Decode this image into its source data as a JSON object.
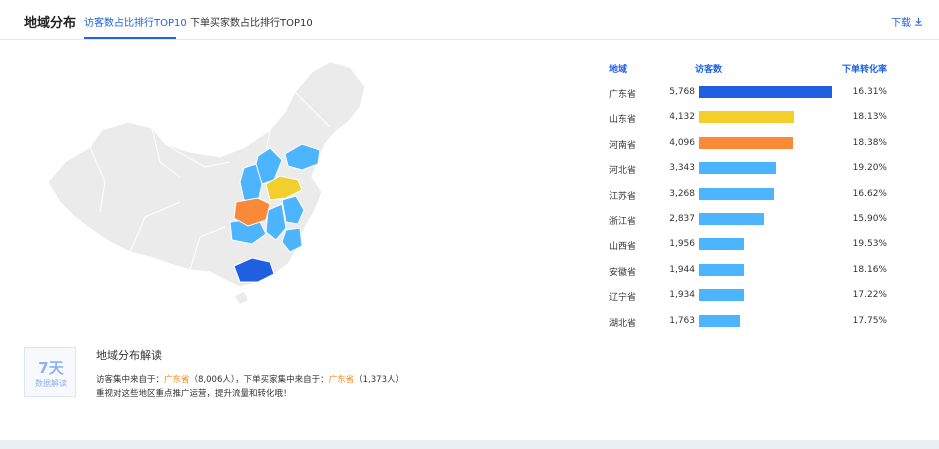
{
  "header": {
    "title": "地域分布",
    "tabs": [
      {
        "label": "访客数占比排行TOP10",
        "active": true
      },
      {
        "label": "下单买家数占比排行TOP10",
        "active": false
      }
    ],
    "download_label": "下载",
    "download_icon": "download-icon"
  },
  "table": {
    "headers": {
      "region": "地域",
      "visitors": "访客数",
      "rate": "下单转化率"
    },
    "max_visitors": 5768,
    "rows": [
      {
        "province": "广东省",
        "visitors": "5,768",
        "value": 5768,
        "rate": "16.31%",
        "color": "#1f5fe0"
      },
      {
        "province": "山东省",
        "visitors": "4,132",
        "value": 4132,
        "rate": "18.13%",
        "color": "#f2cf2d"
      },
      {
        "province": "河南省",
        "visitors": "4,096",
        "value": 4096,
        "rate": "18.38%",
        "color": "#fb8a38"
      },
      {
        "province": "河北省",
        "visitors": "3,343",
        "value": 3343,
        "rate": "19.20%",
        "color": "#4db4ff"
      },
      {
        "province": "江苏省",
        "visitors": "3,268",
        "value": 3268,
        "rate": "16.62%",
        "color": "#4db4ff"
      },
      {
        "province": "浙江省",
        "visitors": "2,837",
        "value": 2837,
        "rate": "15.90%",
        "color": "#4db4ff"
      },
      {
        "province": "山西省",
        "visitors": "1,956",
        "value": 1956,
        "rate": "19.53%",
        "color": "#4db4ff"
      },
      {
        "province": "安徽省",
        "visitors": "1,944",
        "value": 1944,
        "rate": "18.16%",
        "color": "#4db4ff"
      },
      {
        "province": "辽宁省",
        "visitors": "1,934",
        "value": 1934,
        "rate": "17.22%",
        "color": "#4db4ff"
      },
      {
        "province": "湖北省",
        "visitors": "1,763",
        "value": 1763,
        "rate": "17.75%",
        "color": "#4db4ff"
      }
    ]
  },
  "insight": {
    "badge_big": "7天",
    "badge_small": "数据解读",
    "title": "地域分布解读",
    "line1_a": "访客集中来自于：",
    "line1_b": "广东省",
    "line1_c": "（8,006人），下单买家集中来自于：",
    "line1_d": "广东省",
    "line1_e": "（1,373人）",
    "line2": "重视对这些地区重点推广运营，提升流量和转化哦！"
  },
  "colors": {
    "accent": "#2062e6",
    "map_base": "#ebebeb",
    "map_light": "#4db4ff",
    "map_top": "#1f5fe0",
    "map_second": "#f2cf2d",
    "map_third": "#fb8a38",
    "highlight_text": "#f18a1a"
  }
}
